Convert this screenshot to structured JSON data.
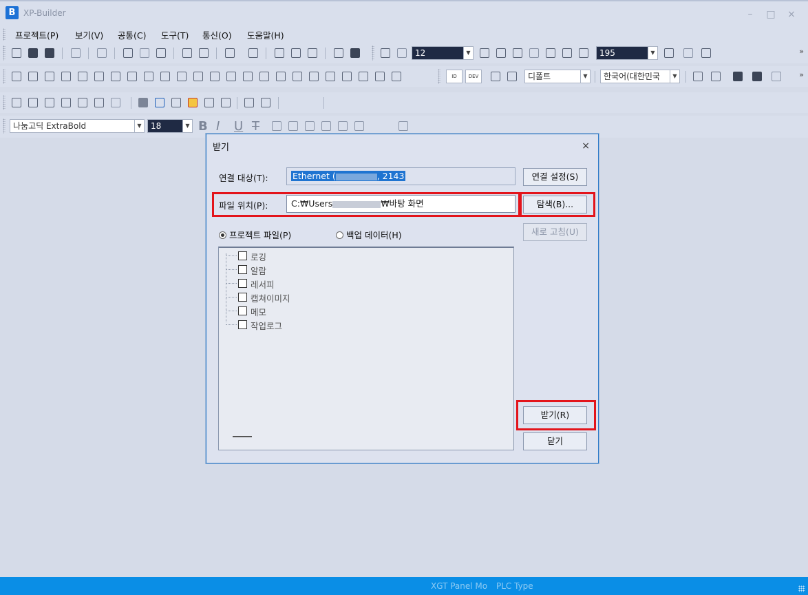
{
  "app": {
    "logo": "B",
    "title": "XP-Builder",
    "minimize": "–",
    "maximize": "□",
    "close": "×"
  },
  "menu": [
    "프로젝트(P)",
    "보기(V)",
    "공통(C)",
    "도구(T)",
    "통신(O)",
    "도움말(H)"
  ],
  "toolbar": {
    "zoom_value": "12",
    "zoom2_value": "195",
    "style_combo": "디폴트",
    "language_combo": "한국어(대한민국",
    "font_combo": "나눔고딕 ExtraBold",
    "font_size": "18",
    "overflow": "»",
    "bold": "B",
    "italic": "I",
    "underline": "U",
    "strike": "T",
    "badge_id": "ID",
    "badge_dev": "DEV"
  },
  "dialog": {
    "title": "받기",
    "close": "×",
    "connection_label": "연결 대상(T):",
    "connection_value_prefix": "Ethernet (",
    "connection_value_suffix": ", 2143",
    "connection_settings_button": "연결 설정(S)",
    "file_location_label": "파일 위치(P):",
    "file_location_prefix": "C:₩Users",
    "file_location_suffix": "₩바탕 화면",
    "browse_button": "탐색(B)...",
    "refresh_button": "새로 고침(U)",
    "radio_project": "프로젝트 파일(P)",
    "radio_backup": "백업 데이터(H)",
    "tree_items": [
      "로깅",
      "알람",
      "레서피",
      "캡쳐이미지",
      "메모",
      "작업로그"
    ],
    "receive_button": "받기(R)",
    "close_button": "닫기"
  },
  "status": {
    "panel": "XGT Panel Mo",
    "plc_type": "PLC Type"
  },
  "colors": {
    "accent": "#1d72d6",
    "status_bar": "#0a8ee6",
    "highlight": "#e3141b"
  }
}
